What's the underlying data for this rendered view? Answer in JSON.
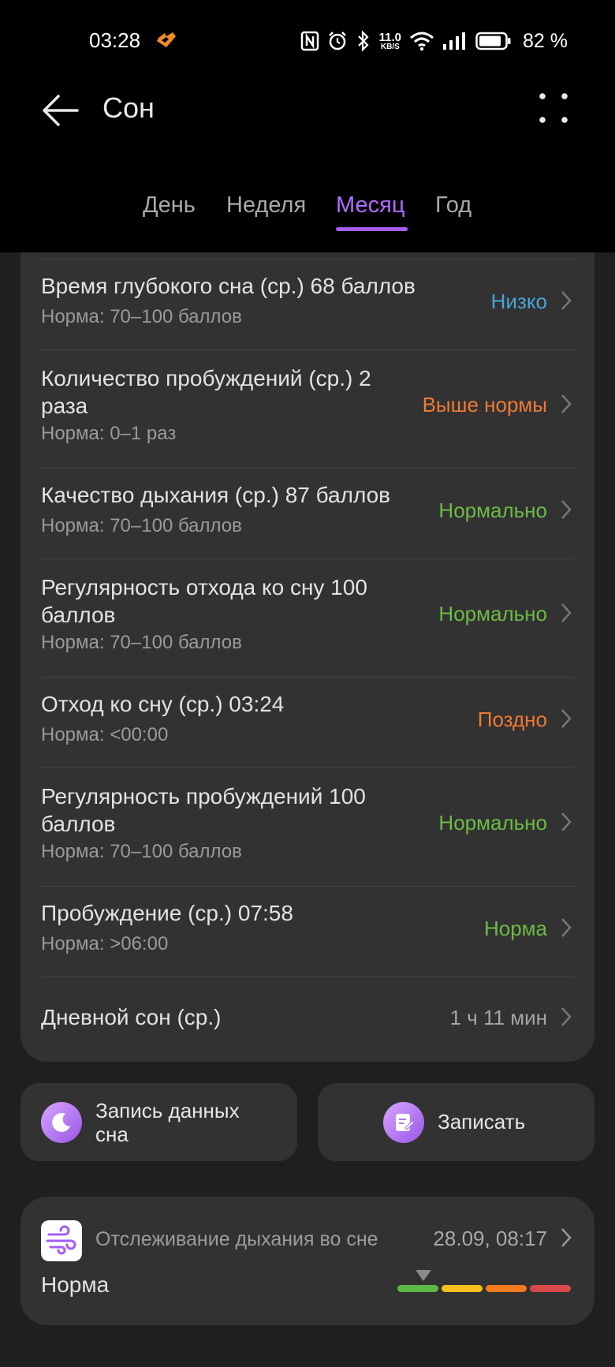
{
  "status_bar": {
    "time": "03:28",
    "net_speed_value": "11.0",
    "net_speed_unit": "KB/S",
    "battery_percent": "82 %",
    "icons": [
      "app-notification-icon",
      "nfc-icon",
      "alarm-icon",
      "bluetooth-icon",
      "wifi-icon",
      "signal-icon",
      "battery-icon"
    ]
  },
  "header": {
    "title": "Сон",
    "back_icon": "back-arrow-icon",
    "more_icon": "more-dots-icon"
  },
  "tabs": [
    {
      "label": "День",
      "active": false
    },
    {
      "label": "Неделя",
      "active": false
    },
    {
      "label": "Месяц",
      "active": true
    },
    {
      "label": "Год",
      "active": false
    }
  ],
  "colors": {
    "accent": "#a55df2",
    "low": "#4ba4d9",
    "high": "#f07a35",
    "normal": "#6dbb45"
  },
  "metrics": [
    {
      "title": "Время глубокого сна (ср.)  68 баллов",
      "norm": "Норма: 70–100 баллов",
      "status": "Низко"
    },
    {
      "title": "Количество пробуждений (ср.)  2 раза",
      "norm": "Норма: 0–1 раз",
      "status": "Выше нормы"
    },
    {
      "title": "Качество дыхания (ср.)  87 баллов",
      "norm": "Норма: 70–100 баллов",
      "status": "Нормально"
    },
    {
      "title": "Регулярность отхода ко сну  100 баллов",
      "norm": "Норма: 70–100 баллов",
      "status": "Нормально"
    },
    {
      "title": "Отход ко сну (ср.)  03:24",
      "norm": "Норма: <00:00",
      "status": "Поздно"
    },
    {
      "title": "Регулярность пробуждений  100 баллов",
      "norm": "Норма: 70–100 баллов",
      "status": "Нормально"
    },
    {
      "title": "Пробуждение (ср.)  07:58",
      "norm": "Норма: >06:00",
      "status": "Норма"
    },
    {
      "title": "Дневной сон (ср.)",
      "norm": "",
      "status": "1 ч 11 мин"
    }
  ],
  "actions": {
    "record_data_label": "Запись данных сна",
    "record_data_icon": "sleep-moon-icon",
    "write_label": "Записать",
    "write_icon": "note-edit-icon"
  },
  "breathing": {
    "title": "Отслеживание дыхания во сне",
    "datetime": "28.09, 08:17",
    "status": "Норма",
    "icon": "breathing-wind-icon",
    "scale_colors": [
      "#5cb848",
      "#f5c01c",
      "#f07a1c",
      "#d9484a"
    ],
    "scale_level": 0.1
  }
}
